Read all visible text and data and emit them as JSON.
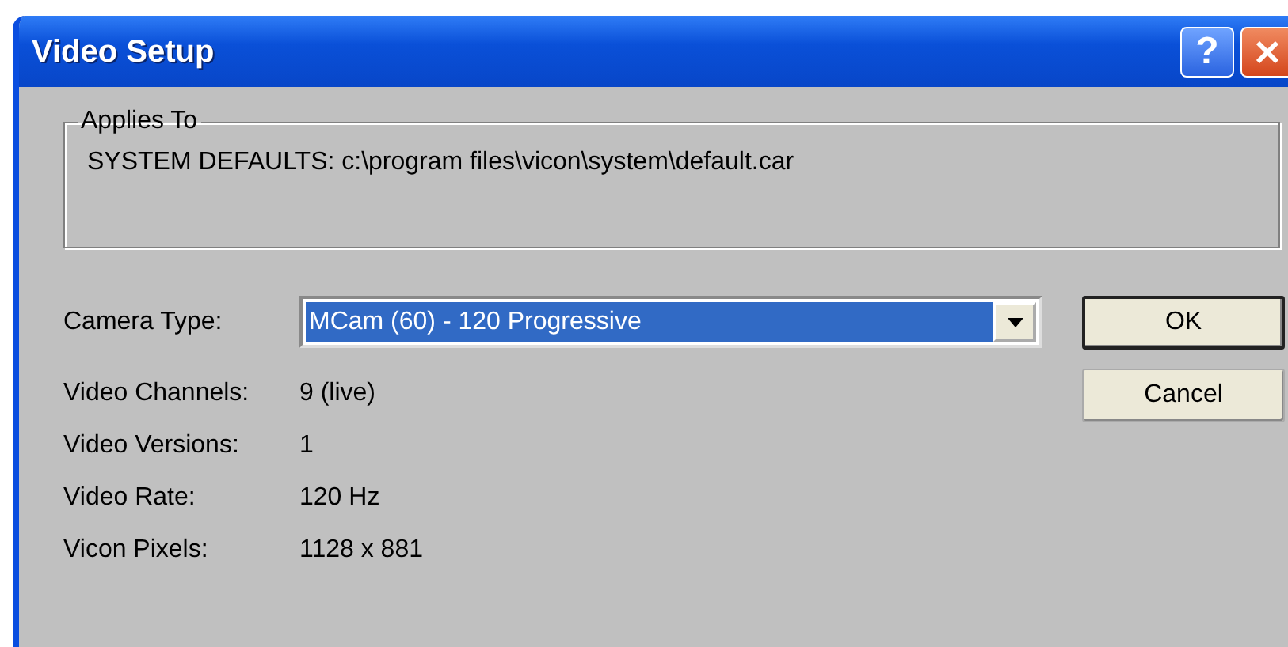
{
  "window": {
    "title": "Video Setup",
    "help_button": "?"
  },
  "applies_to": {
    "title": "Applies To",
    "text": "SYSTEM DEFAULTS: c:\\program files\\vicon\\system\\default.car"
  },
  "camera_type": {
    "label": "Camera Type:",
    "value": "MCam (60) - 120 Progressive",
    "focused": true
  },
  "info": [
    {
      "label": "Video Channels:",
      "value": "9 (live)"
    },
    {
      "label": "Video Versions:",
      "value": "1"
    },
    {
      "label": "Video Rate:",
      "value": "120 Hz"
    },
    {
      "label": "Vicon Pixels:",
      "value": "1128 x 881"
    }
  ],
  "buttons": [
    {
      "label": "OK",
      "default": true
    },
    {
      "label": "Cancel",
      "default": false
    }
  ]
}
